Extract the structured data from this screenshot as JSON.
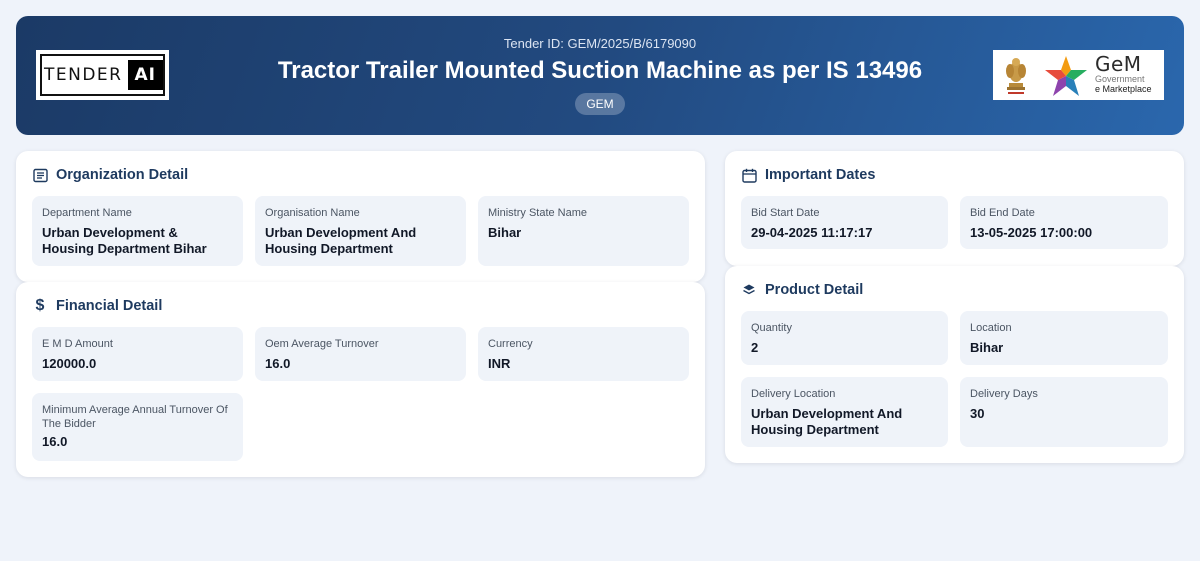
{
  "header": {
    "tender_id": "Tender ID: GEM/2025/B/6179090",
    "title": "Tractor Trailer Mounted Suction Machine as per IS 13496",
    "badge": "GEM",
    "logo_left": {
      "text_a": "TENDER",
      "text_b": "AI"
    },
    "logo_right": {
      "brand": "GeM",
      "line1": "Government",
      "line2": "e Marketplace"
    }
  },
  "organization": {
    "title": "Organization Detail",
    "icon": "document-list-icon",
    "fields": [
      {
        "label": "Department Name",
        "value": "Urban Development & Housing Department Bihar"
      },
      {
        "label": "Organisation Name",
        "value": "Urban Development And Housing Department"
      },
      {
        "label": "Ministry State Name",
        "value": "Bihar"
      }
    ]
  },
  "financial": {
    "title": "Financial Detail",
    "icon": "dollar-icon",
    "fields": [
      {
        "label": "E M D Amount",
        "value": "120000.0"
      },
      {
        "label": "Oem Average Turnover",
        "value": "16.0"
      },
      {
        "label": "Currency",
        "value": "INR"
      },
      {
        "label": "Minimum Average Annual Turnover Of The Bidder",
        "value": "16.0"
      }
    ]
  },
  "dates": {
    "title": "Important Dates",
    "icon": "calendar-icon",
    "fields": [
      {
        "label": "Bid Start Date",
        "value": "29-04-2025 11:17:17"
      },
      {
        "label": "Bid End Date",
        "value": "13-05-2025 17:00:00"
      }
    ]
  },
  "product": {
    "title": "Product Detail",
    "icon": "layers-icon",
    "fields": [
      {
        "label": "Quantity",
        "value": "2"
      },
      {
        "label": "Location",
        "value": "Bihar"
      },
      {
        "label": "Delivery Location",
        "value": "Urban Development And Housing Department"
      },
      {
        "label": "Delivery Days",
        "value": "30"
      }
    ]
  },
  "colors": {
    "header_gradient_start": "#1b3a66",
    "header_gradient_end": "#2a67ad",
    "page_background": "#eff3fa",
    "field_background": "#eff3f9",
    "heading_text": "#1e3a5f"
  }
}
